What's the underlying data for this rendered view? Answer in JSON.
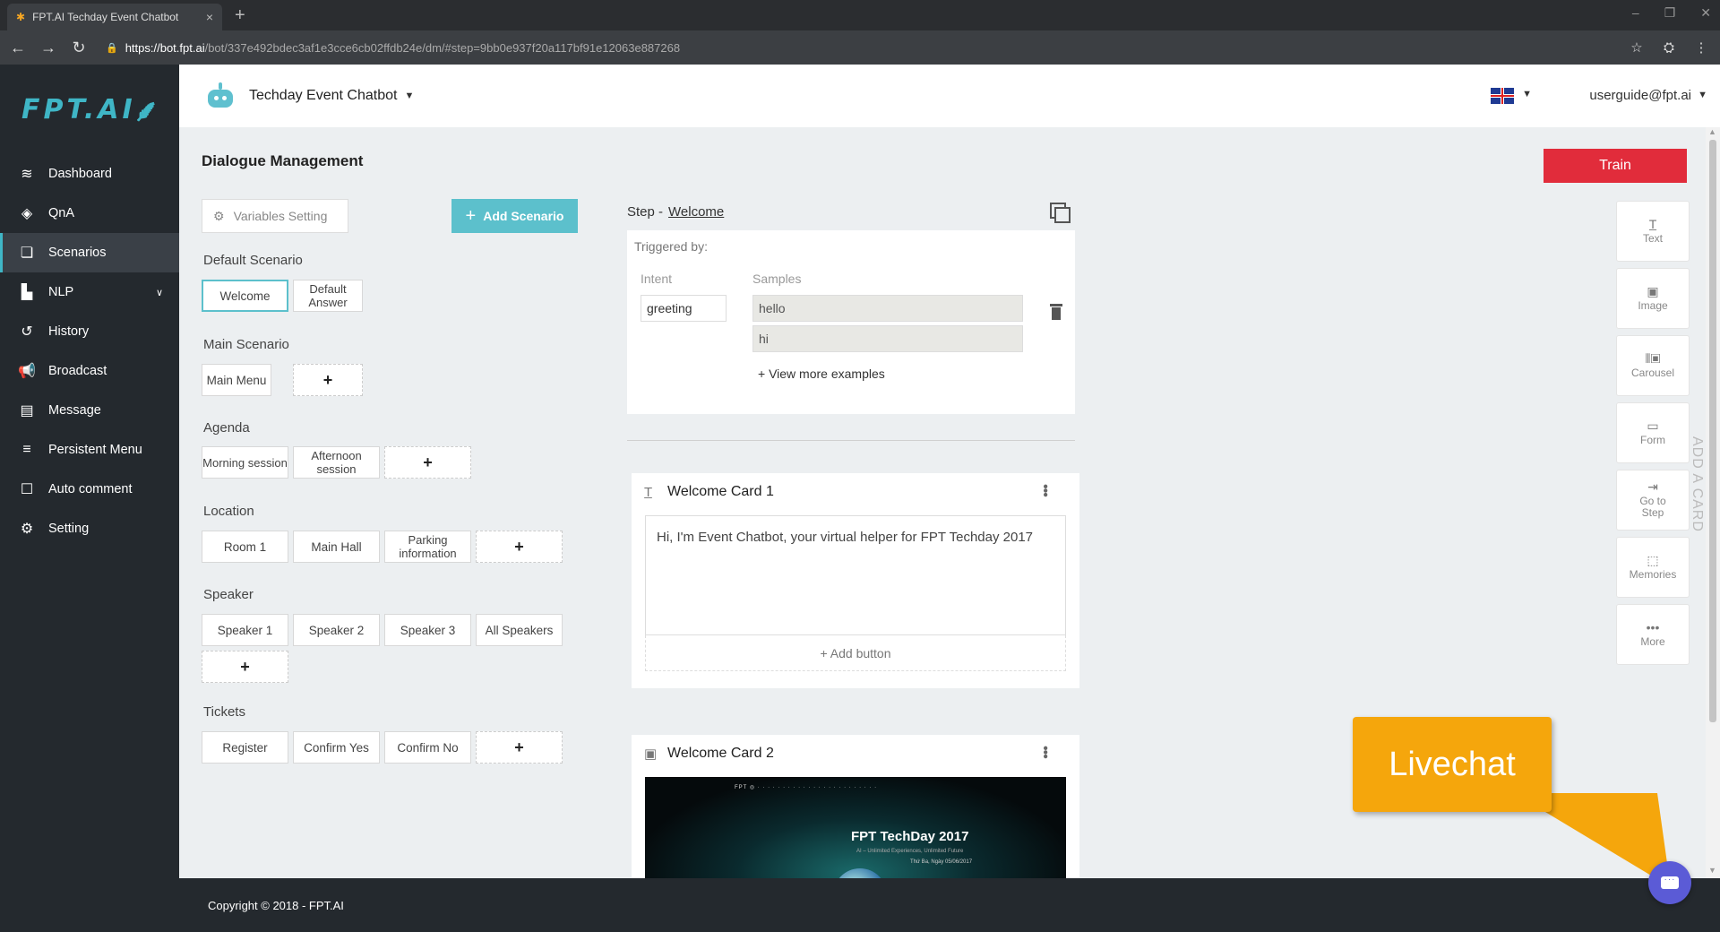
{
  "browser": {
    "tab_title": "FPT.AI Techday Event Chatbot",
    "url_host": "https://bot.fpt.ai",
    "url_path": "/bot/337e492bdec3af1e3cce6cb02ffdb24e/dm/#step=9bb0e937f20a117bf91e12063e887268"
  },
  "sidebar": {
    "logo": "FPT.AI",
    "items": [
      {
        "label": "Dashboard",
        "icon": "layers-icon"
      },
      {
        "label": "QnA",
        "icon": "qna-icon"
      },
      {
        "label": "Scenarios",
        "icon": "scenarios-icon"
      },
      {
        "label": "NLP",
        "icon": "nlp-icon"
      },
      {
        "label": "History",
        "icon": "history-icon"
      },
      {
        "label": "Broadcast",
        "icon": "megaphone-icon"
      },
      {
        "label": "Message",
        "icon": "message-icon"
      },
      {
        "label": "Persistent Menu",
        "icon": "menu-icon"
      },
      {
        "label": "Auto comment",
        "icon": "comment-icon"
      },
      {
        "label": "Setting",
        "icon": "gear-icon"
      }
    ]
  },
  "header": {
    "bot_name": "Techday Event Chatbot",
    "user": "userguide@fpt.ai"
  },
  "dm": {
    "title": "Dialogue Management",
    "variables_btn": "Variables Setting",
    "add_scenario_btn": "Add Scenario",
    "sections": {
      "default": {
        "title": "Default Scenario",
        "chips": [
          "Welcome",
          "Default Answer"
        ]
      },
      "main": {
        "title": "Main Scenario",
        "chips": [
          "Main Menu"
        ]
      },
      "agenda": {
        "title": "Agenda",
        "chips": [
          "Morning session",
          "Afternoon session"
        ]
      },
      "location": {
        "title": "Location",
        "chips": [
          "Room 1",
          "Main Hall",
          "Parking information"
        ]
      },
      "speaker": {
        "title": "Speaker",
        "chips": [
          "Speaker 1",
          "Speaker 2",
          "Speaker 3",
          "All Speakers"
        ]
      },
      "tickets": {
        "title": "Tickets",
        "chips": [
          "Register",
          "Confirm Yes",
          "Confirm No"
        ]
      }
    },
    "plus": "+"
  },
  "main": {
    "train_btn": "Train",
    "step_label": "Step -",
    "step_name": "Welcome",
    "triggered_by": "Triggered by:",
    "intent_label": "Intent",
    "samples_label": "Samples",
    "intent_value": "greeting",
    "samples": [
      "hello",
      "hi"
    ],
    "view_more": "+ View more examples",
    "card1": {
      "title": "Welcome Card 1",
      "text": "Hi,  I'm Event Chatbot, your virtual helper for FPT Techday 2017",
      "add_button": "+ Add button"
    },
    "card2": {
      "title": "Welcome Card 2",
      "image_title": "FPT TechDay 2017",
      "image_sub": "AI – Unlimited Experiences, Unlimited Future",
      "image_date": "Thứ Ba, Ngày 05/06/2017"
    },
    "tools": [
      {
        "label": "Text",
        "icon": "text-icon"
      },
      {
        "label": "Image",
        "icon": "image-icon"
      },
      {
        "label": "Carousel",
        "icon": "carousel-icon"
      },
      {
        "label": "Form",
        "icon": "form-icon"
      },
      {
        "label": "Go to Step",
        "icon": "goto-icon"
      },
      {
        "label": "Memories",
        "icon": "memories-icon"
      },
      {
        "label": "More",
        "icon": "more-icon"
      }
    ],
    "add_a_card": "ADD A CARD"
  },
  "livechat": "Livechat",
  "footer": "Copyright © 2018 - FPT.AI"
}
